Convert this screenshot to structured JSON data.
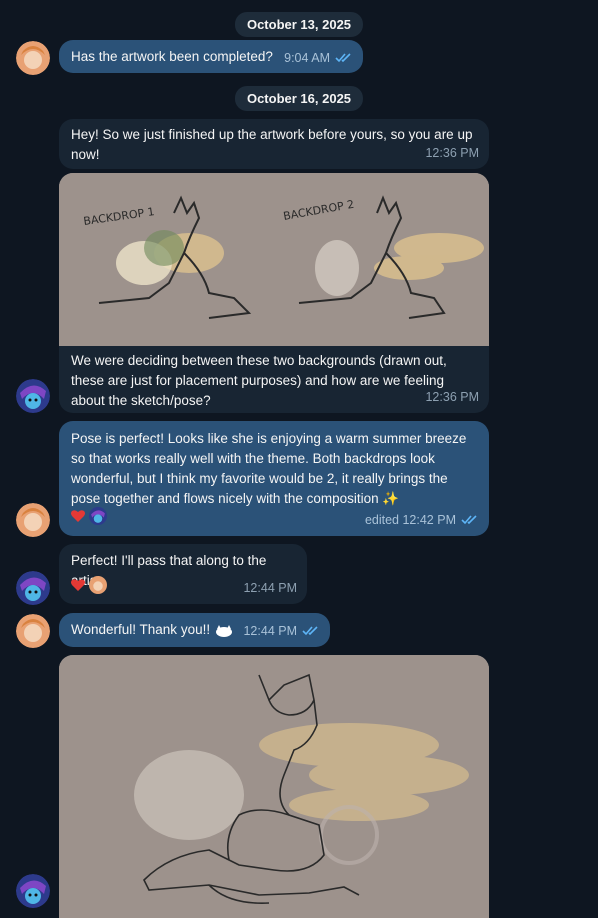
{
  "dates": [
    "October 13, 2025",
    "October 16, 2025"
  ],
  "messages": {
    "m1": {
      "text": "Has the artwork been completed?",
      "time": "9:04 AM"
    },
    "m2": {
      "text": "Hey! So we just finished up the artwork before yours, so you are up now!",
      "time": "12:36 PM"
    },
    "m3": {
      "text": "We were deciding between these two backgrounds (drawn out, these are just for placement purposes) and how are we feeling about the sketch/pose?",
      "time": "12:36 PM"
    },
    "m4": {
      "text": "Pose is perfect! Looks like she is enjoying a warm summer breeze so that works really well with the theme. Both backdrops look wonderful, but I think my favorite would be 2, it really brings the pose together and flows nicely with the composition  ✨",
      "time": "edited 12:42 PM"
    },
    "m5": {
      "text": "Perfect! I'll pass that along to the artist",
      "time": "12:44 PM"
    },
    "m6": {
      "text": "Wonderful! Thank you!!",
      "time": "12:44 PM"
    }
  },
  "sketch_labels": {
    "left": "BACKDROP 1",
    "right": "BACKDROP 2"
  },
  "colors": {
    "bg": "#0e1621",
    "outgoing": "#2b5278",
    "incoming": "#182533",
    "date_pill": "#1e2c3a",
    "checks": "#5eb5f7"
  }
}
